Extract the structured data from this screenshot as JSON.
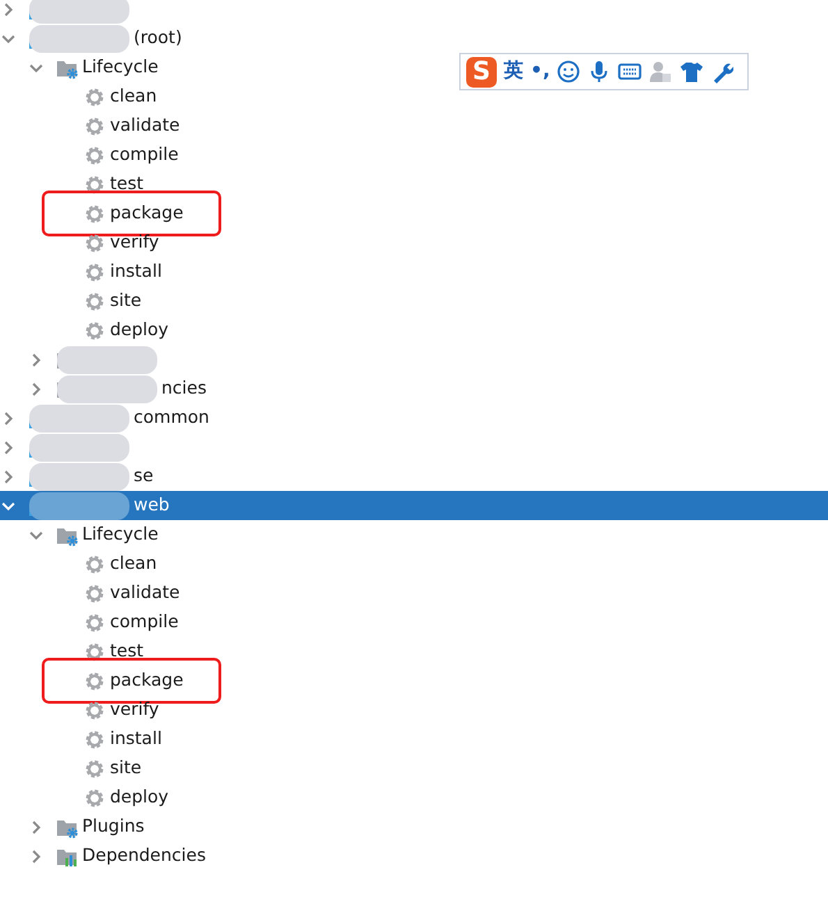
{
  "tree": [
    {
      "kind": "module",
      "redacted": true,
      "expanded": false,
      "selected": false
    },
    {
      "kind": "module",
      "redacted": true,
      "label": "(root)",
      "expanded": true,
      "selected": false,
      "children": [
        {
          "kind": "lifecycle",
          "label": "Lifecycle",
          "expanded": true,
          "selected": false,
          "children": [
            {
              "kind": "goal",
              "label": "clean",
              "marked": false,
              "selected": false
            },
            {
              "kind": "goal",
              "label": "validate",
              "marked": false,
              "selected": false
            },
            {
              "kind": "goal",
              "label": "compile",
              "marked": false,
              "selected": false
            },
            {
              "kind": "goal",
              "label": "test",
              "marked": false,
              "selected": false
            },
            {
              "kind": "goal",
              "label": "package",
              "marked": true,
              "selected": false
            },
            {
              "kind": "goal",
              "label": "verify",
              "marked": false,
              "selected": false
            },
            {
              "kind": "goal",
              "label": "install",
              "marked": false,
              "selected": false
            },
            {
              "kind": "goal",
              "label": "site",
              "marked": false,
              "selected": false
            },
            {
              "kind": "goal",
              "label": "deploy",
              "marked": false,
              "selected": false
            }
          ]
        },
        {
          "kind": "plugins",
          "redacted": true,
          "expanded": false,
          "selected": false
        },
        {
          "kind": "dependencies",
          "redacted": true,
          "label": "ncies",
          "expanded": false,
          "selected": false
        }
      ]
    },
    {
      "kind": "module",
      "redacted": true,
      "label": "common",
      "expanded": false,
      "selected": false
    },
    {
      "kind": "module",
      "redacted": true,
      "expanded": false,
      "selected": false
    },
    {
      "kind": "module",
      "redacted": true,
      "label": "se",
      "expanded": false,
      "selected": false
    },
    {
      "kind": "module",
      "redacted": true,
      "label": "web",
      "expanded": true,
      "selected": true,
      "children": [
        {
          "kind": "lifecycle",
          "label": "Lifecycle",
          "expanded": true,
          "selected": false,
          "children": [
            {
              "kind": "goal",
              "label": "clean",
              "marked": false,
              "selected": false
            },
            {
              "kind": "goal",
              "label": "validate",
              "marked": false,
              "selected": false
            },
            {
              "kind": "goal",
              "label": "compile",
              "marked": false,
              "selected": false
            },
            {
              "kind": "goal",
              "label": "test",
              "marked": false,
              "selected": false
            },
            {
              "kind": "goal",
              "label": "package",
              "marked": true,
              "selected": false
            },
            {
              "kind": "goal",
              "label": "verify",
              "marked": false,
              "selected": false
            },
            {
              "kind": "goal",
              "label": "install",
              "marked": false,
              "selected": false
            },
            {
              "kind": "goal",
              "label": "site",
              "marked": false,
              "selected": false
            },
            {
              "kind": "goal",
              "label": "deploy",
              "marked": false,
              "selected": false
            }
          ]
        },
        {
          "kind": "plugins",
          "label": "Plugins",
          "expanded": false,
          "selected": false
        },
        {
          "kind": "dependencies",
          "label": "Dependencies",
          "expanded": false,
          "selected": false
        }
      ]
    }
  ],
  "ime_toolbar": {
    "logo": "S",
    "language": "英",
    "punctuation": "•,"
  }
}
